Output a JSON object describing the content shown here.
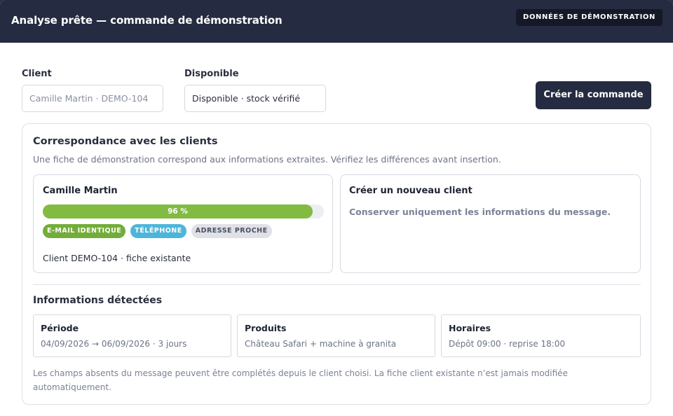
{
  "header": {
    "title": "Analyse prête — commande de démonstration",
    "badge": "DONNÉES DE DÉMONSTRATION"
  },
  "form": {
    "client_label": "Client",
    "client_placeholder": "Camille Martin · DEMO-104",
    "available_label": "Disponible",
    "available_value": "Disponible · stock vérifié",
    "create_button": "Créer la commande"
  },
  "matching": {
    "title": "Correspondance avec les clients",
    "subtitle": "Une fiche de démonstration correspond aux informations extraites. Vérifiez les différences avant insertion.",
    "candidate": {
      "name": "Camille Martin",
      "score": 96,
      "score_label": "96 %",
      "tags": [
        {
          "label": "E-MAIL IDENTIQUE",
          "color": "#73ad39"
        },
        {
          "label": "TÉLÉPHONE",
          "color": "#4db6d8"
        },
        {
          "label": "ADRESSE PROCHE",
          "color": "#dfe1e6"
        }
      ],
      "footer": "Client DEMO-104 · fiche existante"
    },
    "new_client": {
      "title": "Créer un nouveau client",
      "subtitle": "Conserver uniquement les informations du message."
    }
  },
  "detected": {
    "title": "Informations détectées",
    "items": [
      {
        "label": "Période",
        "value": "04/09/2026 → 06/09/2026 · 3 jours"
      },
      {
        "label": "Produits",
        "value": "Château Safari + machine à granita"
      },
      {
        "label": "Horaires",
        "value": "Dépôt 09:00 · reprise 18:00"
      }
    ],
    "footnote": "Les champs absents du message peuvent être complétés depuis le client choisi. La fiche client existante n’est jamais modifiée automatiquement."
  },
  "colors": {
    "header_bg": "#252b40",
    "accent_green": "#82bb42",
    "accent_blue": "#4db6d8",
    "primary_button": "#252b40"
  }
}
